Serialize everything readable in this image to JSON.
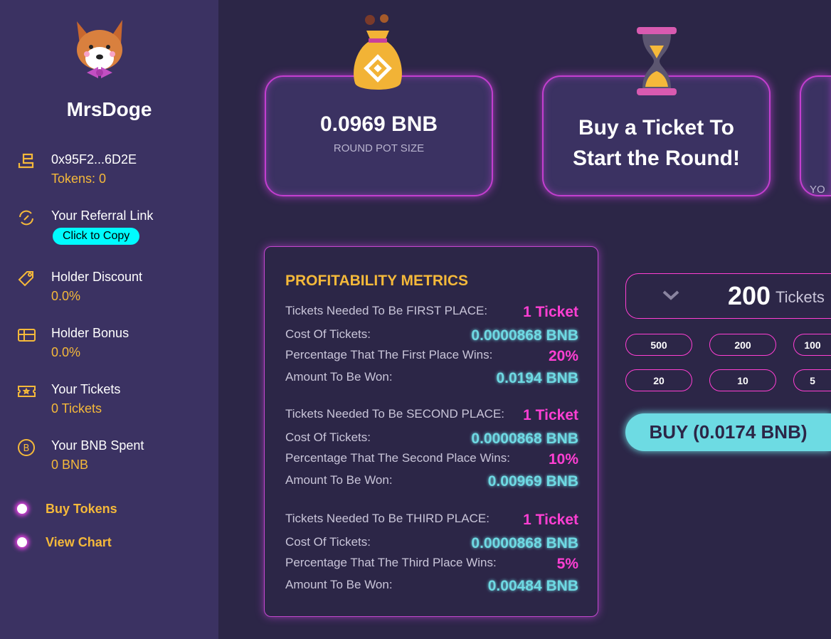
{
  "sidebar": {
    "brand": "MrsDoge",
    "wallet": {
      "address": "0x95F2...6D2E",
      "tokens": "Tokens: 0"
    },
    "referral": {
      "label": "Your Referral Link",
      "button": "Click to Copy"
    },
    "discount": {
      "label": "Holder Discount",
      "value": "0.0%"
    },
    "bonus": {
      "label": "Holder Bonus",
      "value": "0.0%"
    },
    "tickets": {
      "label": "Your Tickets",
      "value": "0 Tickets"
    },
    "spent": {
      "label": "Your BNB Spent",
      "value": "0 BNB"
    },
    "links": [
      "Buy Tokens",
      "View Chart"
    ]
  },
  "cards": {
    "pot": {
      "value": "0.0969 BNB",
      "label": "ROUND POT SIZE"
    },
    "round": {
      "line1": "Buy a Ticket To",
      "line2": "Start the Round!"
    },
    "third": {
      "label": "YO"
    }
  },
  "metrics": {
    "title": "PROFITABILITY METRICS",
    "groups": [
      {
        "rows": [
          [
            "Tickets Needed To Be FIRST PLACE:",
            "1 Ticket"
          ],
          [
            "Cost Of Tickets:",
            "0.0000868 BNB"
          ],
          [
            "Percentage That The First Place Wins:",
            "20%"
          ],
          [
            "Amount To Be Won:",
            "0.0194 BNB"
          ]
        ]
      },
      {
        "rows": [
          [
            "Tickets Needed To Be SECOND PLACE:",
            "1 Ticket"
          ],
          [
            "Cost Of Tickets:",
            "0.0000868 BNB"
          ],
          [
            "Percentage That The Second Place Wins:",
            "10%"
          ],
          [
            "Amount To Be Won:",
            "0.00969 BNB"
          ]
        ]
      },
      {
        "rows": [
          [
            "Tickets Needed To Be THIRD PLACE:",
            "1 Ticket"
          ],
          [
            "Cost Of Tickets:",
            "0.0000868 BNB"
          ],
          [
            "Percentage That The Third Place Wins:",
            "5%"
          ],
          [
            "Amount To Be Won:",
            "0.00484 BNB"
          ]
        ]
      }
    ]
  },
  "buy": {
    "count": "200",
    "unit": "Tickets",
    "quick": [
      "500",
      "200",
      "100",
      "20",
      "10",
      "5"
    ],
    "button": "BUY (0.0174 BNB)"
  }
}
